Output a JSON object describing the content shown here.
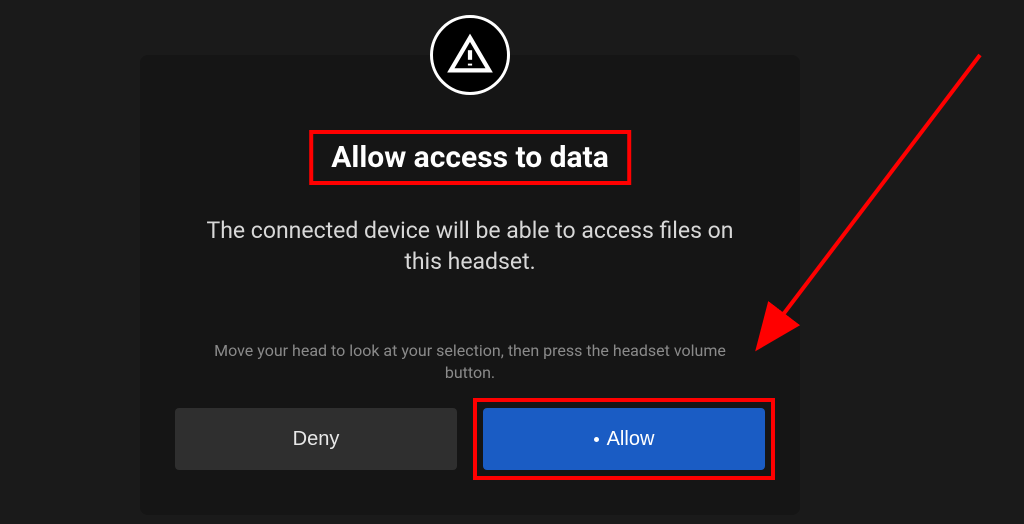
{
  "dialog": {
    "icon_name": "warning-triangle-icon",
    "title": "Allow access to data",
    "body": "The connected device will be able to access files on this headset.",
    "hint": "Move your head to look at your selection, then press the headset volume button.",
    "deny_label": "Deny",
    "allow_label": "Allow"
  },
  "annotation": {
    "highlight_color": "#ff0000",
    "arrow_color": "#ff0000"
  }
}
